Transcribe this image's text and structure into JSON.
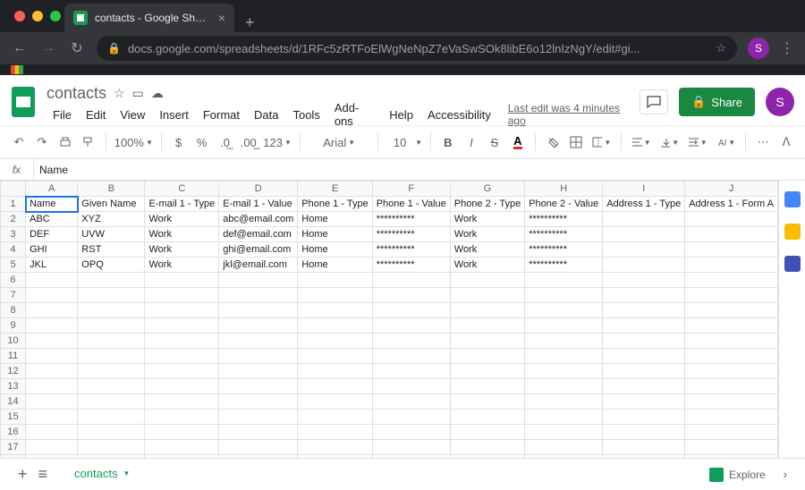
{
  "browser": {
    "tab_title": "contacts - Google Sheets",
    "url_display": "docs.google.com/spreadsheets/d/1RFc5zRTFoElWgNeNpZ7eVaSwSOk8libE6o12lnIzNgY/edit#gi...",
    "avatar_letter": "S"
  },
  "doc": {
    "title": "contacts",
    "last_edit": "Last edit was 4 minutes ago",
    "share_label": "Share"
  },
  "menus": [
    "File",
    "Edit",
    "View",
    "Insert",
    "Format",
    "Data",
    "Tools",
    "Add-ons",
    "Help",
    "Accessibility"
  ],
  "toolbar": {
    "zoom": "100%",
    "font": "Arial",
    "size": "10",
    "more": "123"
  },
  "formula": {
    "label": "fx",
    "value": "Name"
  },
  "columns": [
    "A",
    "B",
    "C",
    "D",
    "E",
    "F",
    "G",
    "H",
    "I",
    "J"
  ],
  "rows_visible": 18,
  "headers": [
    "Name",
    "Given Name",
    "E-mail 1 - Type",
    "E-mail 1 - Value",
    "Phone 1 - Type",
    "Phone 1 - Value",
    "Phone 2 - Type",
    "Phone 2 - Value",
    "Address 1 - Type",
    "Address 1 - Form A"
  ],
  "data": [
    [
      "ABC",
      "XYZ",
      "Work",
      "abc@email.com",
      "Home",
      "**********",
      "Work",
      "**********",
      "",
      ""
    ],
    [
      "DEF",
      "UVW",
      "Work",
      "def@email.com",
      "Home",
      "**********",
      "Work",
      "**********",
      "",
      ""
    ],
    [
      "GHI",
      "RST",
      "Work",
      "ghi@email.com",
      "Home",
      "**********",
      "Work",
      "**********",
      "",
      ""
    ],
    [
      "JKL",
      "OPQ",
      "Work",
      "jkl@email.com",
      "Home",
      "**********",
      "Work",
      "**********",
      "",
      ""
    ]
  ],
  "sheet_tab": "contacts",
  "explore_label": "Explore"
}
